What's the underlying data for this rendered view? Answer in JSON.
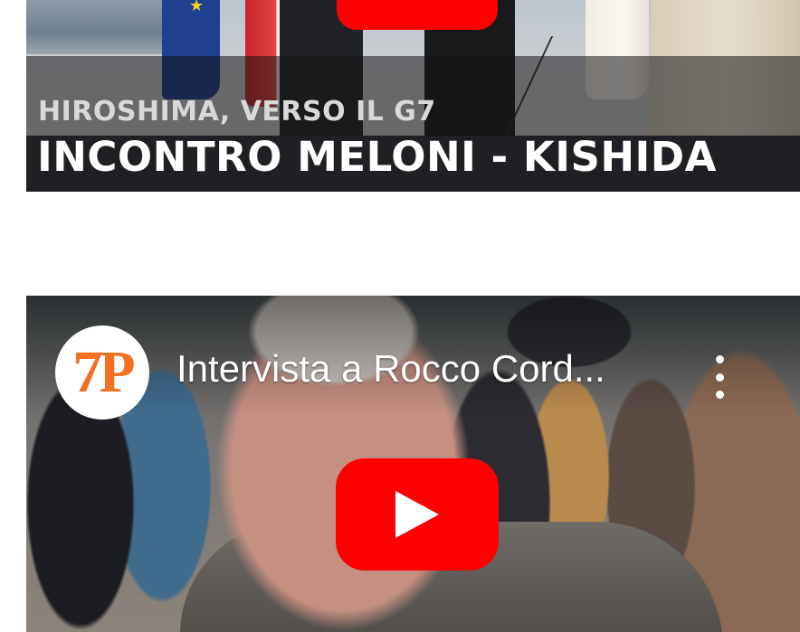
{
  "video1": {
    "kicker": "HIROSHIMA, VERSO IL G7",
    "title": "INCONTRO MELONI - KISHIDA"
  },
  "video2": {
    "channel_logo_text": "7P",
    "title": "Intervista a Rocco Cord..."
  },
  "colors": {
    "youtube_red": "#ff0000",
    "logo_orange": "#f37021",
    "logo_red": "#e0261c"
  },
  "icons": [
    "youtube-play-icon",
    "more-vert-icon"
  ]
}
